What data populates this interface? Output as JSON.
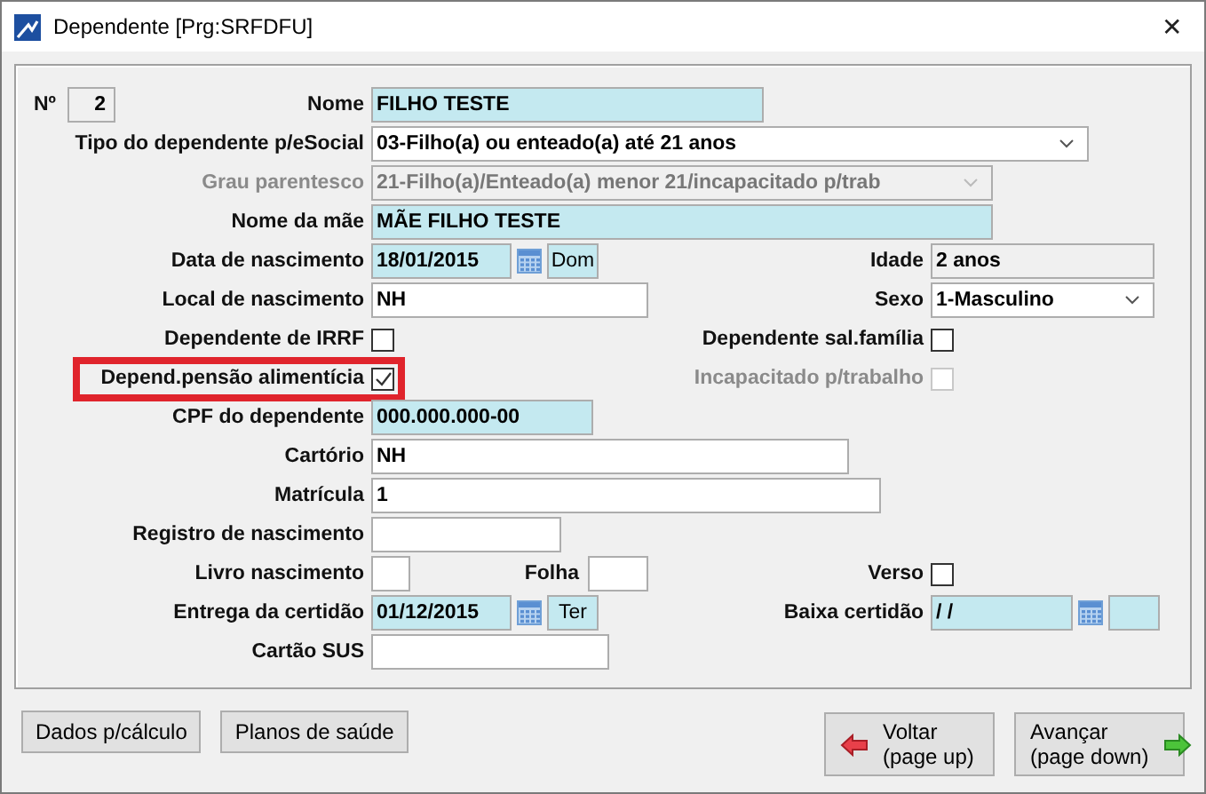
{
  "window": {
    "title": "Dependente [Prg:SRFDFU]",
    "close": "✕"
  },
  "form": {
    "number_label": "Nº",
    "number": "2",
    "rows": [
      {
        "left": {
          "label": "Nome",
          "kind": "text",
          "value": "FILHO TESTE",
          "required": true
        }
      },
      {
        "left": {
          "label": "Tipo do dependente p/eSocial",
          "kind": "select",
          "value": "03-Filho(a) ou enteado(a) até 21 anos"
        }
      },
      {
        "left": {
          "label": "Grau parentesco",
          "kind": "select",
          "value": "21-Filho(a)/Enteado(a) menor 21/incapacitado p/trab",
          "disabled": true
        }
      },
      {
        "left": {
          "label": "Nome da mãe",
          "kind": "text",
          "value": "MÃE FILHO TESTE",
          "required": true
        }
      },
      {
        "left": {
          "label": "Data de nascimento",
          "kind": "date",
          "value": "18/01/2015",
          "weekday": "Dom",
          "required": true
        },
        "right": {
          "label": "Idade",
          "kind": "readonly",
          "value": "2 anos"
        }
      },
      {
        "left": {
          "label": "Local de nascimento",
          "kind": "text",
          "value": "NH"
        },
        "right": {
          "label": "Sexo",
          "kind": "select",
          "value": "1-Masculino"
        }
      },
      {
        "left": {
          "label": "Dependente de IRRF",
          "kind": "checkbox",
          "checked": false
        },
        "right": {
          "label": "Dependente sal.família",
          "kind": "checkbox",
          "checked": false
        }
      },
      {
        "left": {
          "label": "Depend.pensão alimentícia",
          "kind": "checkbox",
          "checked": true,
          "highlighted": true
        },
        "right": {
          "label": "Incapacitado p/trabalho",
          "kind": "checkbox",
          "checked": false,
          "disabled": true
        }
      },
      {
        "left": {
          "label": "CPF do dependente",
          "kind": "text",
          "value": "000.000.000-00",
          "required": true
        }
      },
      {
        "left": {
          "label": "Cartório",
          "kind": "text",
          "value": "NH"
        }
      },
      {
        "left": {
          "label": "Matrícula",
          "kind": "text",
          "value": "1"
        }
      },
      {
        "left": {
          "label": "Registro de nascimento",
          "kind": "text"
        }
      },
      {
        "left": {
          "label": "Livro nascimento",
          "kind": "text"
        },
        "middle": {
          "label": "Folha",
          "kind": "text"
        },
        "right": {
          "label": "Verso",
          "kind": "checkbox",
          "checked": false
        }
      },
      {
        "left": {
          "label": "Entrega da certidão",
          "kind": "date",
          "value": "01/12/2015",
          "weekday": "Ter",
          "required": true
        },
        "right": {
          "label": "Baixa certidão",
          "kind": "date",
          "value": " / /",
          "required": true
        }
      },
      {
        "left": {
          "label": "Cartão SUS",
          "kind": "text"
        }
      }
    ]
  },
  "buttons": [
    "Dados p/cálculo",
    "Planos de saúde"
  ],
  "nav": [
    {
      "kind": "back",
      "label": "Voltar",
      "hint": "(page up)"
    },
    {
      "kind": "forward",
      "label": "Avançar",
      "hint": "(page down)"
    }
  ]
}
